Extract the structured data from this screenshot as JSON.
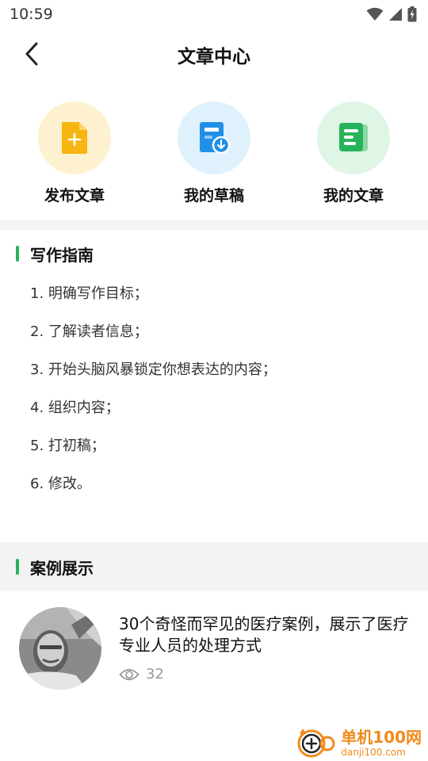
{
  "status_bar": {
    "time": "10:59"
  },
  "header": {
    "title": "文章中心"
  },
  "shortcuts": [
    {
      "label": "发布文章",
      "icon": "add-file-icon",
      "bg": "#fdf1cf",
      "color": "#f7b511"
    },
    {
      "label": "我的草稿",
      "icon": "draft-download-icon",
      "bg": "#dff1fc",
      "color": "#1f8fe8"
    },
    {
      "label": "我的文章",
      "icon": "article-list-icon",
      "bg": "#dff5e6",
      "color": "#27b35a"
    }
  ],
  "guide": {
    "title": "写作指南",
    "items": [
      "1. 明确写作目标；",
      "2. 了解读者信息；",
      "3. 开始头脑风暴锁定你想表达的内容；",
      "4. 组织内容；",
      "5. 打初稿；",
      "6. 修改。"
    ]
  },
  "cases": {
    "title": "案例展示",
    "items": [
      {
        "title": "30个奇怪而罕见的医疗案例，展示了医疗专业人员的处理方式",
        "views": "32",
        "icon": "eye-icon"
      }
    ]
  },
  "watermark": {
    "main": "单机100网",
    "sub": "danji100.com"
  },
  "colors": {
    "accent": "#27b35a",
    "section_bg": "#f3f3f3",
    "watermark": "#f08a1c"
  }
}
